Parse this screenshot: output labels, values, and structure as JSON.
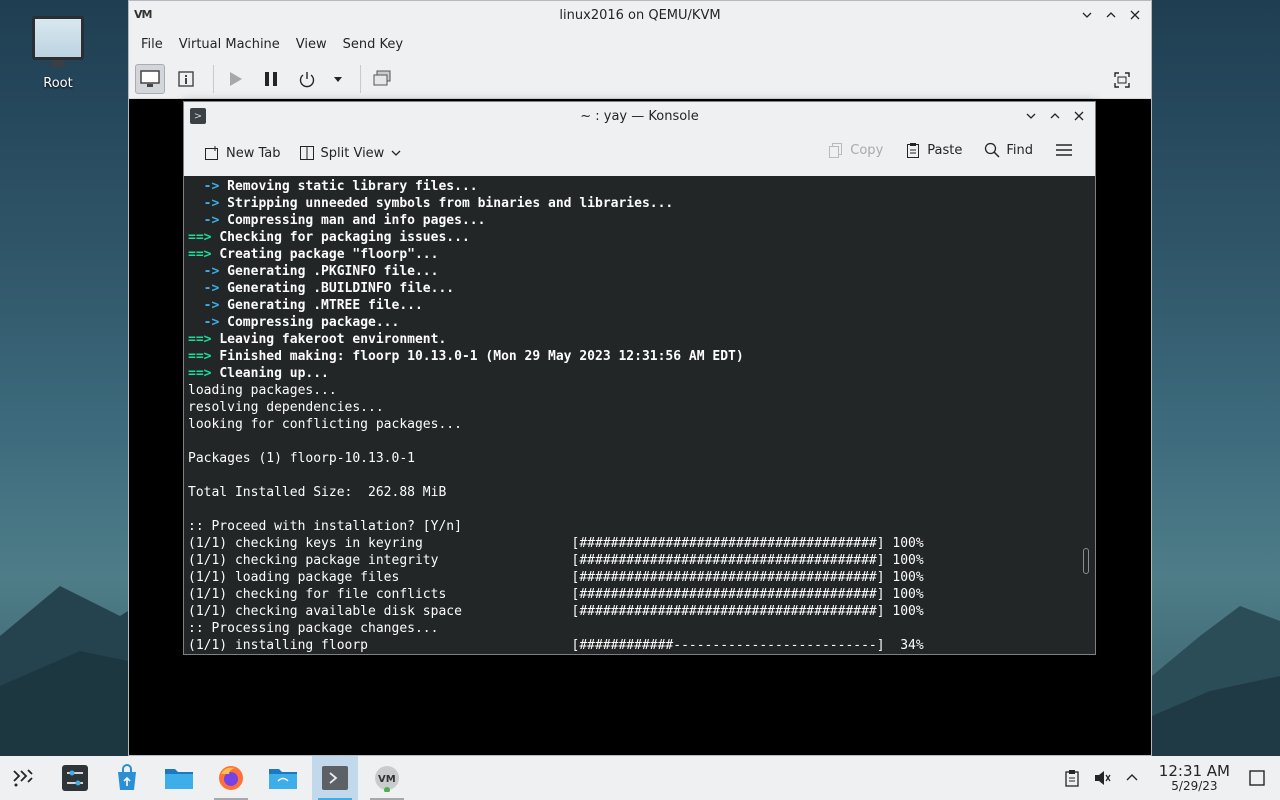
{
  "desktop": {
    "icon_label": "Root"
  },
  "vm_window": {
    "title": "linux2016 on QEMU/KVM",
    "logo_text": "VM",
    "menus": [
      "File",
      "Virtual Machine",
      "View",
      "Send Key"
    ]
  },
  "konsole": {
    "title": "~ : yay — Konsole",
    "toolbar": {
      "new_tab": "New Tab",
      "split_view": "Split View",
      "copy": "Copy",
      "paste": "Paste",
      "find": "Find"
    },
    "lines": [
      [
        {
          "t": "  -> ",
          "c": "bl"
        },
        {
          "t": "Removing static library files...",
          "c": "b"
        }
      ],
      [
        {
          "t": "  -> ",
          "c": "bl"
        },
        {
          "t": "Stripping unneeded symbols from binaries and libraries...",
          "c": "b"
        }
      ],
      [
        {
          "t": "  -> ",
          "c": "bl"
        },
        {
          "t": "Compressing man and info pages...",
          "c": "b"
        }
      ],
      [
        {
          "t": "==> ",
          "c": "g"
        },
        {
          "t": "Checking for packaging issues...",
          "c": "b"
        }
      ],
      [
        {
          "t": "==> ",
          "c": "g"
        },
        {
          "t": "Creating package \"floorp\"...",
          "c": "b"
        }
      ],
      [
        {
          "t": "  -> ",
          "c": "bl"
        },
        {
          "t": "Generating .PKGINFO file...",
          "c": "b"
        }
      ],
      [
        {
          "t": "  -> ",
          "c": "bl"
        },
        {
          "t": "Generating .BUILDINFO file...",
          "c": "b"
        }
      ],
      [
        {
          "t": "  -> ",
          "c": "bl"
        },
        {
          "t": "Generating .MTREE file...",
          "c": "b"
        }
      ],
      [
        {
          "t": "  -> ",
          "c": "bl"
        },
        {
          "t": "Compressing package...",
          "c": "b"
        }
      ],
      [
        {
          "t": "==> ",
          "c": "g"
        },
        {
          "t": "Leaving fakeroot environment.",
          "c": "b"
        }
      ],
      [
        {
          "t": "==> ",
          "c": "g"
        },
        {
          "t": "Finished making: floorp 10.13.0-1 (Mon 29 May 2023 12:31:56 AM EDT)",
          "c": "b"
        }
      ],
      [
        {
          "t": "==> ",
          "c": "g"
        },
        {
          "t": "Cleaning up...",
          "c": "b"
        }
      ],
      [
        {
          "t": "loading packages...",
          "c": ""
        }
      ],
      [
        {
          "t": "resolving dependencies...",
          "c": ""
        }
      ],
      [
        {
          "t": "looking for conflicting packages...",
          "c": ""
        }
      ],
      [
        {
          "t": "",
          "c": ""
        }
      ],
      [
        {
          "t": "Packages (1) floorp-10.13.0-1",
          "c": ""
        }
      ],
      [
        {
          "t": "",
          "c": ""
        }
      ],
      [
        {
          "t": "Total Installed Size:  262.88 MiB",
          "c": ""
        }
      ],
      [
        {
          "t": "",
          "c": ""
        }
      ],
      [
        {
          "t": ":: Proceed with installation? [Y/n]",
          "c": ""
        }
      ],
      [
        {
          "t": "(1/1) checking keys in keyring                   [######################################] 100%",
          "c": ""
        }
      ],
      [
        {
          "t": "(1/1) checking package integrity                 [######################################] 100%",
          "c": ""
        }
      ],
      [
        {
          "t": "(1/1) loading package files                      [######################################] 100%",
          "c": ""
        }
      ],
      [
        {
          "t": "(1/1) checking for file conflicts                [######################################] 100%",
          "c": ""
        }
      ],
      [
        {
          "t": "(1/1) checking available disk space              [######################################] 100%",
          "c": ""
        }
      ],
      [
        {
          "t": ":: Processing package changes...",
          "c": ""
        }
      ],
      [
        {
          "t": "(1/1) installing floorp                          [############--------------------------]  34%",
          "c": ""
        }
      ]
    ]
  },
  "taskbar": {
    "clock_time": "12:31 AM",
    "clock_date": "5/29/23"
  }
}
